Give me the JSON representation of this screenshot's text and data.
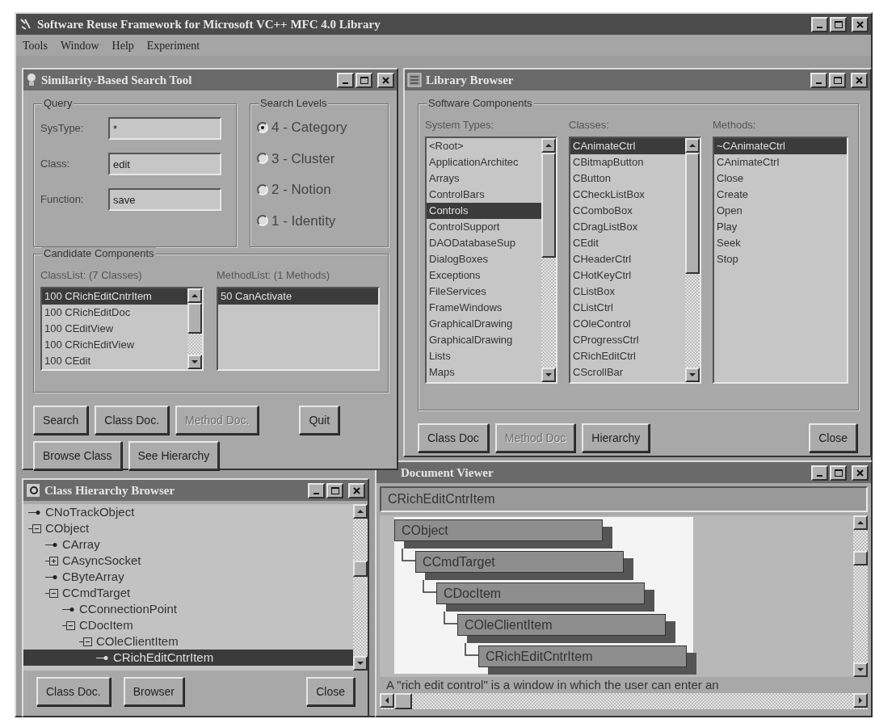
{
  "window": {
    "title": "Software Reuse Framework for Microsoft VC++ MFC 4.0 Library"
  },
  "menu": [
    {
      "label": "Tools"
    },
    {
      "label": "Window"
    },
    {
      "label": "Help"
    },
    {
      "label": "Experiment"
    }
  ],
  "search_tool": {
    "title": "Similarity-Based Search Tool",
    "query": {
      "label": "Query",
      "fields": [
        {
          "label": "SysType:",
          "value": "*"
        },
        {
          "label": "Class:",
          "value": "edit"
        },
        {
          "label": "Function:",
          "value": "save"
        }
      ]
    },
    "search_levels": {
      "label": "Search Levels",
      "options": [
        {
          "label": "4 - Category",
          "selected": true
        },
        {
          "label": "3 - Cluster",
          "selected": false
        },
        {
          "label": "2 - Notion",
          "selected": false
        },
        {
          "label": "1 - Identity",
          "selected": false
        }
      ]
    },
    "candidates": {
      "label": "Candidate Components",
      "class_list": {
        "label": "ClassList: (7 Classes)",
        "items": [
          {
            "text": "100 CRichEditCntrItem",
            "selected": true
          },
          {
            "text": "100 CRichEditDoc",
            "selected": false
          },
          {
            "text": "100 CEditView",
            "selected": false
          },
          {
            "text": "100 CRichEditView",
            "selected": false
          },
          {
            "text": "100 CEdit",
            "selected": false
          }
        ]
      },
      "method_list": {
        "label": "MethodList: (1 Methods)",
        "items": [
          {
            "text": "50 CanActivate",
            "selected": true
          }
        ]
      }
    },
    "buttons": [
      {
        "label": "Search",
        "disabled": false
      },
      {
        "label": "Class Doc.",
        "disabled": false
      },
      {
        "label": "Method Doc.",
        "disabled": true
      },
      {
        "label": "Quit",
        "disabled": false
      },
      {
        "label": "Browse Class",
        "disabled": false
      },
      {
        "label": "See Hierarchy",
        "disabled": false
      }
    ]
  },
  "library_browser": {
    "title": "Library Browser",
    "group": "Software Components",
    "lists": [
      {
        "label": "System Types:",
        "items": [
          {
            "text": "<Root>",
            "selected": false
          },
          {
            "text": "ApplicationArchitec",
            "selected": false
          },
          {
            "text": "Arrays",
            "selected": false
          },
          {
            "text": "ControlBars",
            "selected": false
          },
          {
            "text": "Controls",
            "selected": true
          },
          {
            "text": "ControlSupport",
            "selected": false
          },
          {
            "text": "DAODatabaseSup",
            "selected": false
          },
          {
            "text": "DialogBoxes",
            "selected": false
          },
          {
            "text": "Exceptions",
            "selected": false
          },
          {
            "text": "FileServices",
            "selected": false
          },
          {
            "text": "FrameWindows",
            "selected": false
          },
          {
            "text": "GraphicalDrawing",
            "selected": false
          },
          {
            "text": "GraphicalDrawing",
            "selected": false
          },
          {
            "text": "Lists",
            "selected": false
          },
          {
            "text": "Maps",
            "selected": false
          }
        ]
      },
      {
        "label": "Classes:",
        "items": [
          {
            "text": "CAnimateCtrl",
            "selected": true
          },
          {
            "text": "CBitmapButton",
            "selected": false
          },
          {
            "text": "CButton",
            "selected": false
          },
          {
            "text": "CCheckListBox",
            "selected": false
          },
          {
            "text": "CComboBox",
            "selected": false
          },
          {
            "text": "CDragListBox",
            "selected": false
          },
          {
            "text": "CEdit",
            "selected": false
          },
          {
            "text": "CHeaderCtrl",
            "selected": false
          },
          {
            "text": "CHotKeyCtrl",
            "selected": false
          },
          {
            "text": "CListBox",
            "selected": false
          },
          {
            "text": "CListCtrl",
            "selected": false
          },
          {
            "text": "COleControl",
            "selected": false
          },
          {
            "text": "CProgressCtrl",
            "selected": false
          },
          {
            "text": "CRichEditCtrl",
            "selected": false
          },
          {
            "text": "CScrollBar",
            "selected": false
          }
        ]
      },
      {
        "label": "Methods:",
        "items": [
          {
            "text": "~CAnimateCtrl",
            "selected": true
          },
          {
            "text": "CAnimateCtrl",
            "selected": false
          },
          {
            "text": "Close",
            "selected": false
          },
          {
            "text": "Create",
            "selected": false
          },
          {
            "text": "Open",
            "selected": false
          },
          {
            "text": "Play",
            "selected": false
          },
          {
            "text": "Seek",
            "selected": false
          },
          {
            "text": "Stop",
            "selected": false
          }
        ]
      }
    ],
    "buttons": [
      {
        "label": "Class Doc",
        "disabled": false
      },
      {
        "label": "Method Doc",
        "disabled": true
      },
      {
        "label": "Hierarchy",
        "disabled": false
      },
      {
        "label": "Close",
        "disabled": false
      }
    ]
  },
  "class_hierarchy": {
    "title": "Class Hierarchy Browser",
    "tree": [
      {
        "label": "CNoTrackObject",
        "kind": "leaf",
        "selected": false
      },
      {
        "label": "CObject",
        "kind": "branch",
        "expanded": true,
        "selected": false,
        "children": [
          {
            "label": "CArray",
            "kind": "leaf",
            "selected": false
          },
          {
            "label": "CAsyncSocket",
            "kind": "branch",
            "expanded": false,
            "selected": false
          },
          {
            "label": "CByteArray",
            "kind": "leaf",
            "selected": false
          },
          {
            "label": "CCmdTarget",
            "kind": "branch",
            "expanded": true,
            "selected": false,
            "children": [
              {
                "label": "CConnectionPoint",
                "kind": "leaf",
                "selected": false
              },
              {
                "label": "CDocItem",
                "kind": "branch",
                "expanded": true,
                "selected": false,
                "children": [
                  {
                    "label": "COleClientItem",
                    "kind": "branch",
                    "expanded": true,
                    "selected": false,
                    "children": [
                      {
                        "label": "CRichEditCntrItem",
                        "kind": "leaf",
                        "selected": true
                      }
                    ]
                  }
                ]
              }
            ]
          }
        ]
      }
    ],
    "buttons": [
      {
        "label": "Class Doc."
      },
      {
        "label": "Browser"
      },
      {
        "label": "Close"
      }
    ]
  },
  "document_viewer": {
    "title": "Document Viewer",
    "class_field": "CRichEditCntrItem",
    "diagram": {
      "nodes": [
        {
          "label": "CObject"
        },
        {
          "label": "CCmdTarget"
        },
        {
          "label": "CDocItem"
        },
        {
          "label": "COleClientItem"
        },
        {
          "label": "CRichEditCntrItem"
        }
      ]
    },
    "description": "A \"rich edit control\" is a window in which the user can enter an"
  }
}
